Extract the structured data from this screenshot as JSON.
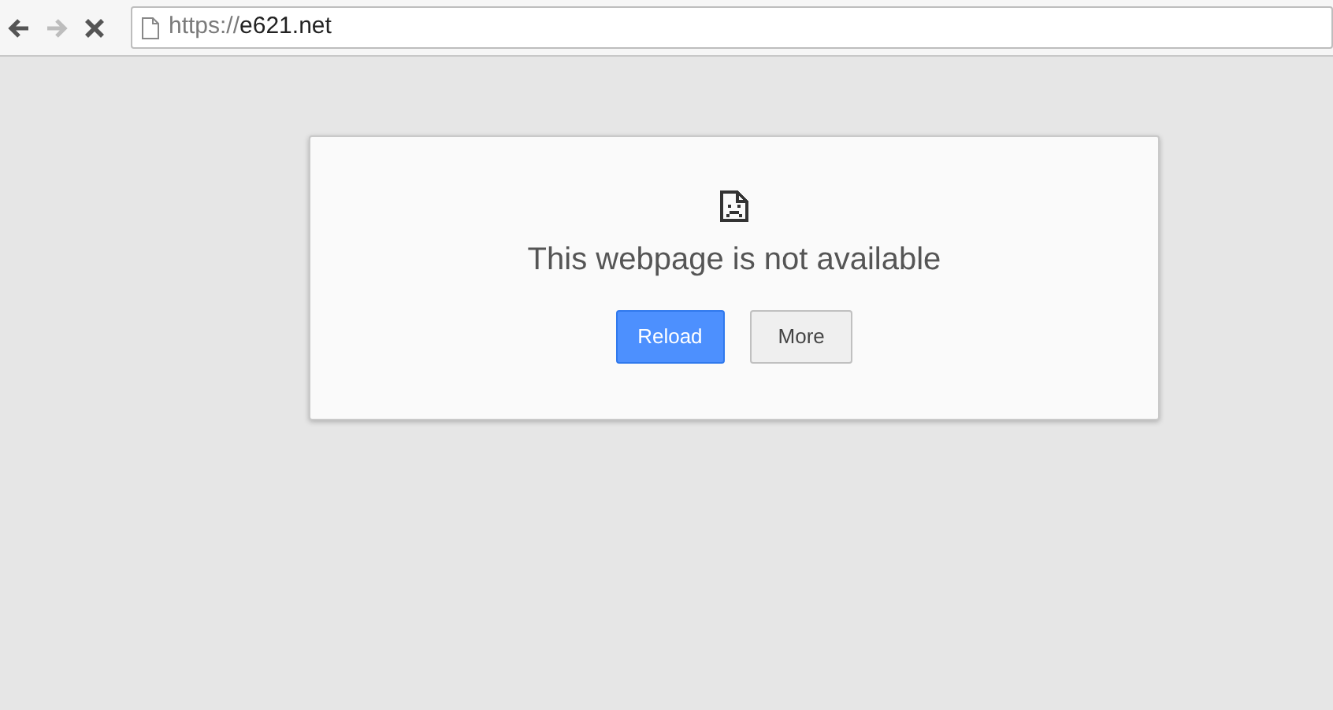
{
  "toolbar": {
    "nav_buttons": [
      {
        "kind": "back",
        "disabled": false
      },
      {
        "kind": "forward",
        "disabled": true
      },
      {
        "kind": "stop",
        "disabled": false
      }
    ],
    "address": {
      "scheme": "https://",
      "host": "e621.net"
    }
  },
  "error_card": {
    "title": "This webpage is not available",
    "buttons": [
      {
        "label": "Reload",
        "kind": "primary"
      },
      {
        "label": "More",
        "kind": "secondary"
      }
    ]
  }
}
